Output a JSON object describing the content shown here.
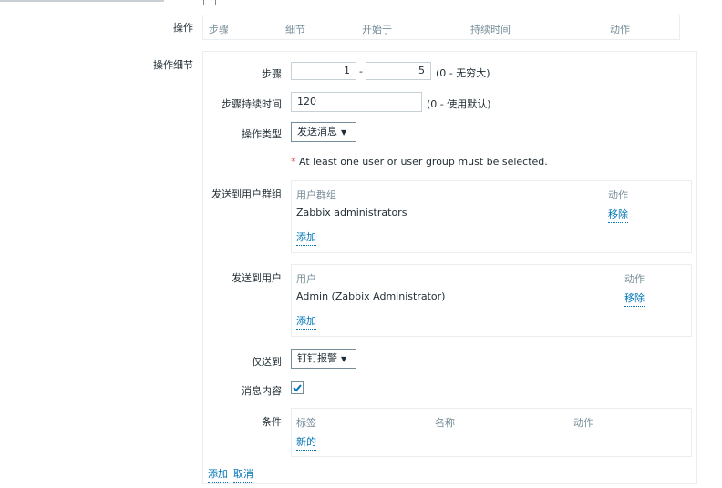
{
  "header_row": {
    "label": "操作",
    "columns": [
      "步骤",
      "细节",
      "开始于",
      "持续时间",
      "动作"
    ]
  },
  "details": {
    "section_label": "操作细节",
    "steps": {
      "label": "步骤",
      "from": "1",
      "separator": "-",
      "to": "5",
      "hint": "(0 - 无穷大)"
    },
    "step_duration": {
      "label": "步骤持续时间",
      "value": "120",
      "hint": "(0 - 使用默认)"
    },
    "operation_type": {
      "label": "操作类型",
      "value": "发送消息"
    },
    "warning": {
      "asterisk": "*",
      "text": "At least one user or user group must be selected."
    },
    "send_to_groups": {
      "label": "发送到用户群组",
      "col_name": "用户群组",
      "col_action": "动作",
      "rows": [
        {
          "name": "Zabbix administrators",
          "action": "移除"
        }
      ],
      "add": "添加"
    },
    "send_to_users": {
      "label": "发送到用户",
      "col_name": "用户",
      "col_action": "动作",
      "rows": [
        {
          "name": "Admin (Zabbix Administrator)",
          "action": "移除"
        }
      ],
      "add": "添加"
    },
    "send_only_to": {
      "label": "仅送到",
      "value": "钉钉报警"
    },
    "default_message": {
      "label": "消息内容",
      "checked": true
    },
    "conditions": {
      "label": "条件",
      "columns": [
        "标签",
        "名称",
        "动作"
      ],
      "new": "新的"
    },
    "footer": {
      "add": "添加",
      "cancel": "取消"
    }
  },
  "colors": {
    "link": "#0275b8",
    "border": "#ebeef0",
    "muted": "#768d99",
    "error": "#e45959",
    "check": "#0275b8"
  }
}
